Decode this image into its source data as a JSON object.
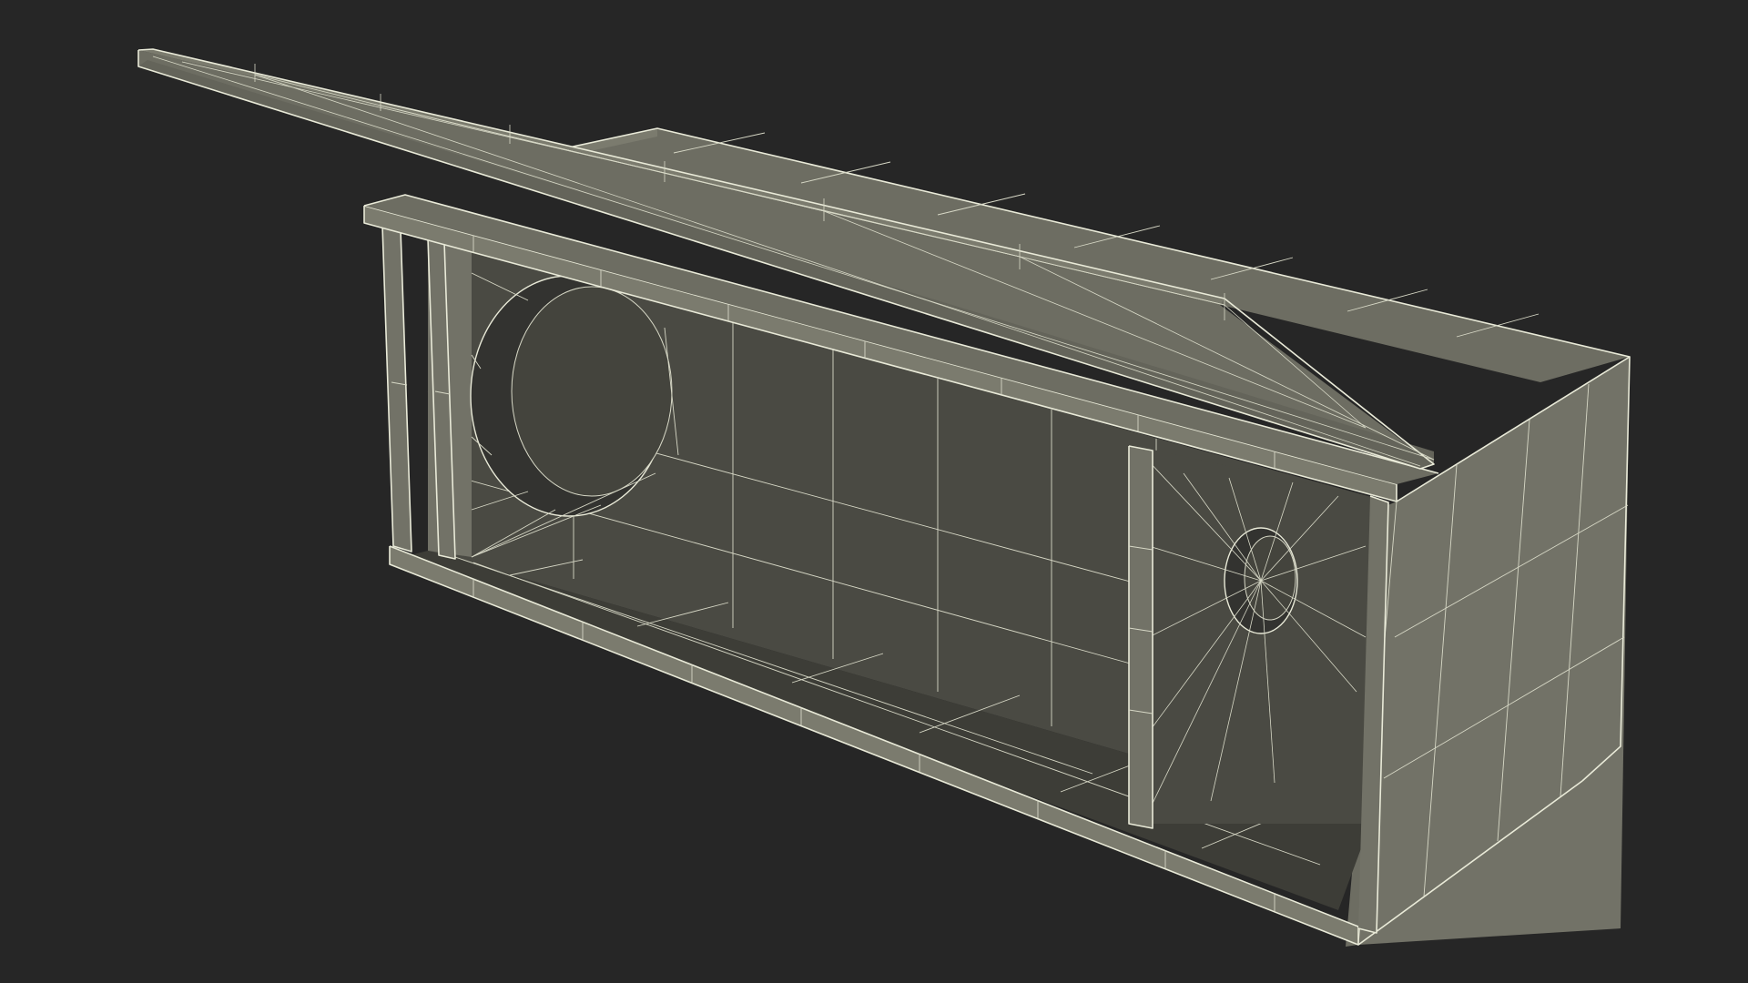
{
  "scene": {
    "background_color": "#262626",
    "object": "wireframe-subwoofer-box-with-open-lid",
    "surface_color": "#76766b",
    "interior_color": "#45453f",
    "wire_color": "#e9ead8"
  }
}
